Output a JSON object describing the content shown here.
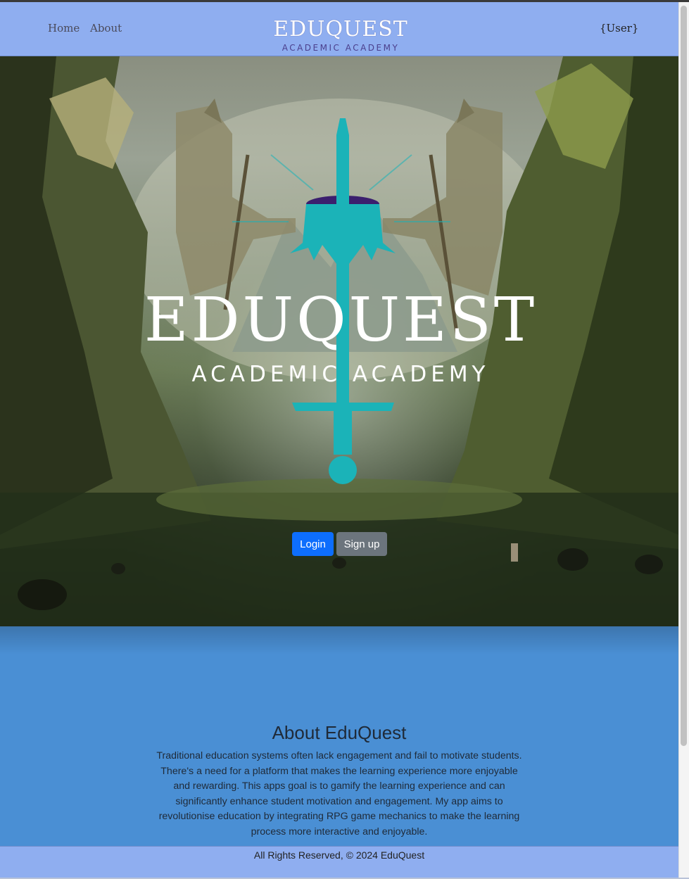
{
  "nav": {
    "home_label": "Home",
    "about_label": "About",
    "brand_title": "EDUQUEST",
    "brand_subtitle": "ACADEMIC ACADEMY",
    "user_label": "{User}"
  },
  "hero": {
    "logo_title": "EDUQUEST",
    "logo_subtitle": "ACADEMIC ACADEMY",
    "login_label": "Login",
    "signup_label": "Sign up"
  },
  "about": {
    "heading": "About EduQuest",
    "text": "Traditional education systems often lack engagement and fail to motivate students. There's a need for a platform that makes the learning experience more enjoyable and rewarding. This apps goal is to gamify the learning experience and can significantly enhance student motivation and engagement. My app aims to revolutionise education by integrating RPG game mechanics to make the learning process more interactive and enjoyable."
  },
  "footer": {
    "text": "All Rights Reserved, © 2024 EduQuest"
  },
  "colors": {
    "navbar": "#8faef0",
    "about_bg": "#4a8fd4",
    "login": "#0d6efd",
    "signup": "#6c757d",
    "logo_teal": "#1bb3b8"
  }
}
